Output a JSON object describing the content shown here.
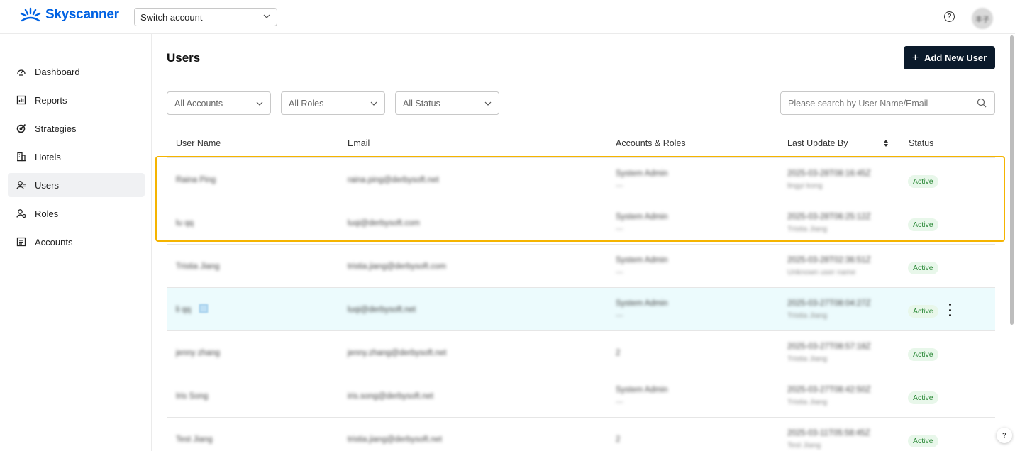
{
  "brand": {
    "name": "Skyscanner",
    "color": "#0062e3"
  },
  "topbar": {
    "switch_account": "Switch account",
    "help_glyph": "?",
    "avatar_initials": "丰子"
  },
  "sidebar": {
    "items": [
      {
        "label": "Dashboard",
        "icon": "dashboard-icon"
      },
      {
        "label": "Reports",
        "icon": "reports-icon"
      },
      {
        "label": "Strategies",
        "icon": "strategies-icon"
      },
      {
        "label": "Hotels",
        "icon": "hotels-icon"
      },
      {
        "label": "Users",
        "icon": "users-icon",
        "active": true
      },
      {
        "label": "Roles",
        "icon": "roles-icon"
      },
      {
        "label": "Accounts",
        "icon": "accounts-icon"
      }
    ]
  },
  "main": {
    "title": "Users",
    "add_button": "Add New User",
    "filters": {
      "accounts": "All Accounts",
      "roles": "All Roles",
      "status": "All Status"
    },
    "search_placeholder": "Please search by User Name/Email",
    "columns": {
      "user_name": "User Name",
      "email": "Email",
      "accounts_roles": "Accounts & Roles",
      "last_update": "Last Update By",
      "status": "Status"
    },
    "rows": [
      {
        "name": "Raina Ping",
        "email": "raina.ping@derbysoft.net",
        "role": "System Admin",
        "role_sub": "—",
        "date": "2025-03-28T08:16:45Z",
        "by": "lingyi kong",
        "status": "Active"
      },
      {
        "name": "lu qq",
        "email": "luqi@derbysoft.com",
        "role": "System Admin",
        "role_sub": "—",
        "date": "2025-03-28T06:25:12Z",
        "by": "Tristia Jiang",
        "status": "Active"
      },
      {
        "name": "Tristia Jiang",
        "email": "tristia.jiang@derbysoft.com",
        "role": "System Admin",
        "role_sub": "—",
        "date": "2025-03-28T02:36:51Z",
        "by": "Unknown user name",
        "status": "Active"
      },
      {
        "name": "li qq",
        "email": "luqi@derbysoft.net",
        "role": "System Admin",
        "role_sub": "—",
        "date": "2025-03-27T08:04:27Z",
        "by": "Tristia Jiang",
        "status": "Active"
      },
      {
        "name": "jenny zhang",
        "email": "jenny.zhang@derbysoft.net",
        "role": "2",
        "role_sub": "",
        "date": "2025-03-27T08:57:18Z",
        "by": "Tristia Jiang",
        "status": "Active"
      },
      {
        "name": "Iris Song",
        "email": "iris.song@derbysoft.net",
        "role": "System Admin",
        "role_sub": "—",
        "date": "2025-03-27T08:42:50Z",
        "by": "Tristia Jiang",
        "status": "Active"
      },
      {
        "name": "Test Jiang",
        "email": "tristia.jiang@derbysoft.net",
        "role": "2",
        "role_sub": "",
        "date": "2025-03-11T05:58:45Z",
        "by": "Test Jiang",
        "status": "Active"
      }
    ]
  },
  "colors": {
    "accent_dark": "#0b1a2b",
    "highlight": "#f5b400",
    "active_badge_bg": "#e8f7ea",
    "active_badge_text": "#2e8b3a",
    "hover_row": "#ecfbfd"
  }
}
